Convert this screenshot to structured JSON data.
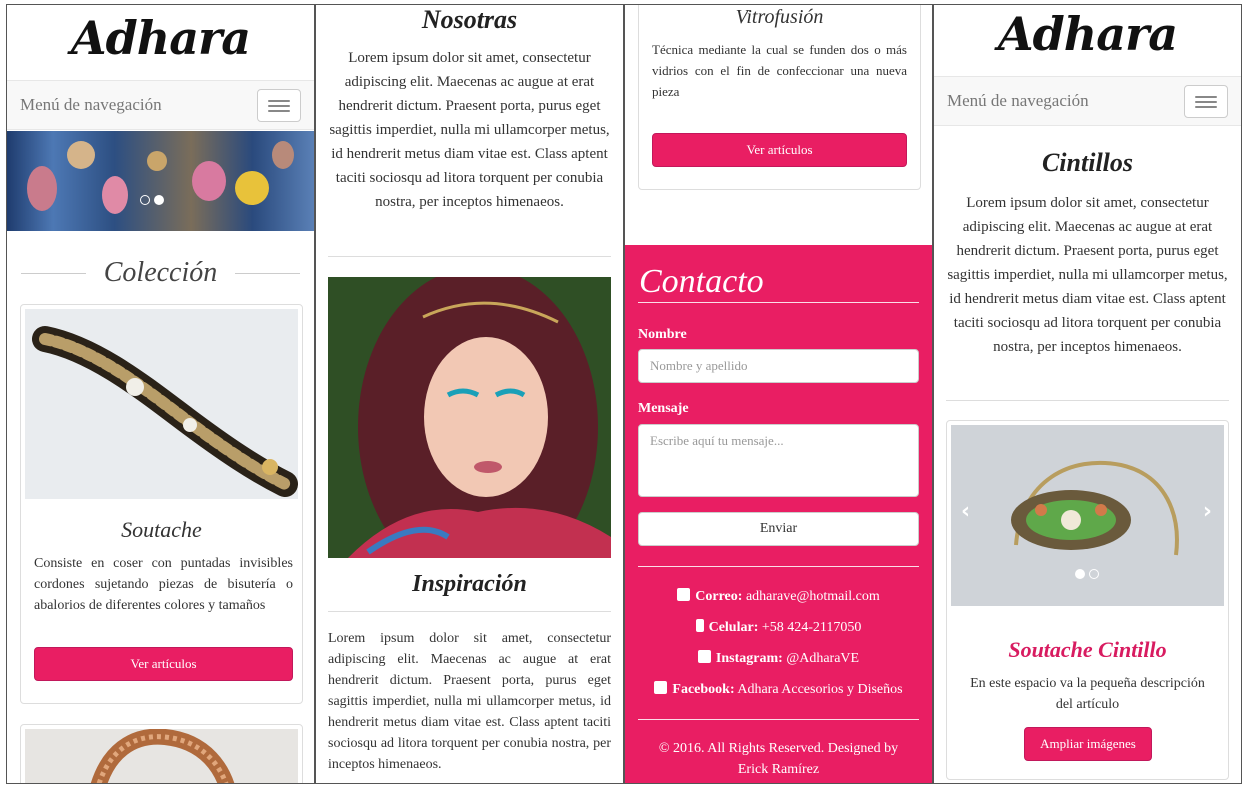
{
  "brand": {
    "logo": "Adhara",
    "nav_label": "Menú de navegación"
  },
  "panel1": {
    "section_title": "Colección",
    "card1": {
      "title": "Soutache",
      "text": "Consiste en coser con puntadas invisibles cordones sujetando piezas de bisutería o abalorios de diferentes colores y tamaños",
      "button": "Ver artículos"
    }
  },
  "panel2": {
    "title1": "Nosotras",
    "para1": "Lorem ipsum dolor sit amet, consectetur adipiscing elit. Maecenas ac augue at erat hendrerit dictum. Praesent porta, purus eget sagittis imperdiet, nulla mi ullamcorper metus, id hendrerit metus diam vitae est. Class aptent taciti sociosqu ad litora torquent per conubia nostra, per inceptos himenaeos.",
    "title2": "Inspiración",
    "para2": "Lorem ipsum dolor sit amet, consectetur adipiscing elit. Maecenas ac augue at erat hendrerit dictum. Praesent porta, purus eget sagittis imperdiet, nulla mi ullamcorper metus, id hendrerit metus diam vitae est. Class aptent taciti sociosqu ad litora torquent per conubia nostra, per inceptos himenaeos."
  },
  "panel3": {
    "card": {
      "title": "Vitrofusión",
      "text": "Técnica mediante la cual se funden dos o más vidrios con el fin de confeccionar una nueva pieza",
      "button": "Ver artículos"
    },
    "contact": {
      "title": "Contacto",
      "name_label": "Nombre",
      "name_placeholder": "Nombre y apellido",
      "message_label": "Mensaje",
      "message_placeholder": "Escribe aquí tu mensaje...",
      "send": "Enviar",
      "email_label": "Correo:",
      "email": "adharave@hotmail.com",
      "phone_label": "Celular:",
      "phone": "+58 424-2117050",
      "instagram_label": "Instagram:",
      "instagram": "@AdharaVE",
      "facebook_label": "Facebook:",
      "facebook": "Adhara Accesorios y Diseños",
      "copyright": "© 2016. All Rights Reserved. Designed by",
      "designer": "Erick Ramírez"
    }
  },
  "panel4": {
    "title": "Cintillos",
    "para": "Lorem ipsum dolor sit amet, consectetur adipiscing elit. Maecenas ac augue at erat hendrerit dictum. Praesent porta, purus eget sagittis imperdiet, nulla mi ullamcorper metus, id hendrerit metus diam vitae est. Class aptent taciti sociosqu ad litora torquent per conubia nostra, per inceptos himenaeos.",
    "product_title": "Soutache Cintillo",
    "product_desc": "En este espacio va la pequeña descripción del artículo",
    "button": "Ampliar imágenes"
  },
  "colors": {
    "accent": "#e91e63",
    "nav_bg": "#f8f8f8"
  }
}
